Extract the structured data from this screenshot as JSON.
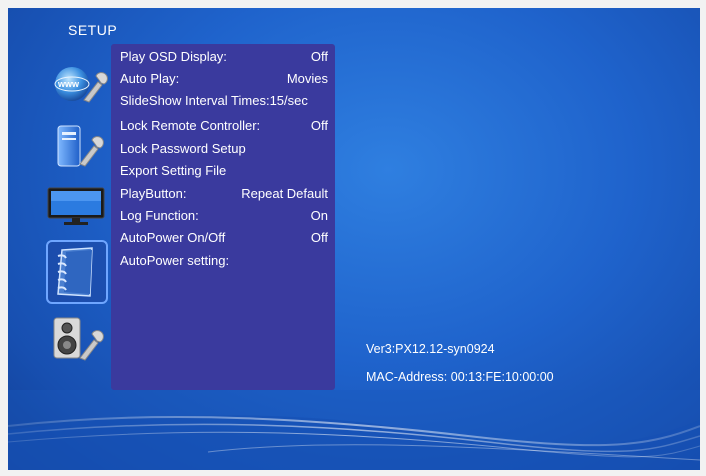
{
  "header": {
    "title": "SETUP"
  },
  "sidebar": {
    "items": [
      {
        "icon": "network-settings-icon",
        "selected": false
      },
      {
        "icon": "system-settings-icon",
        "selected": false
      },
      {
        "icon": "display-settings-icon",
        "selected": false
      },
      {
        "icon": "preferences-notebook-icon",
        "selected": true
      },
      {
        "icon": "audio-settings-icon",
        "selected": false
      }
    ]
  },
  "menu": {
    "items": [
      {
        "label": "Play OSD Display:",
        "value": "Off"
      },
      {
        "label": "Auto Play:",
        "value": "Movies"
      },
      {
        "label": "SlideShow Interval Times:",
        "value": "15/sec"
      },
      {
        "label": "Lock Remote Controller:",
        "value": "Off"
      },
      {
        "label": "Lock Password Setup",
        "value": ""
      },
      {
        "label": "Export Setting File",
        "value": ""
      },
      {
        "label": "PlayButton:",
        "value": "Repeat Default"
      },
      {
        "label": "Log Function:",
        "value": "On"
      },
      {
        "label": "AutoPower On/Off",
        "value": "Off"
      },
      {
        "label": "AutoPower setting:",
        "value": ""
      }
    ]
  },
  "info": {
    "version": "Ver3:PX12.12-syn0924",
    "mac": "MAC-Address: 00:13:FE:10:00:00"
  },
  "colors": {
    "background": "#1f63cc",
    "panel": "#3a3a9e",
    "text": "#ffffff"
  }
}
